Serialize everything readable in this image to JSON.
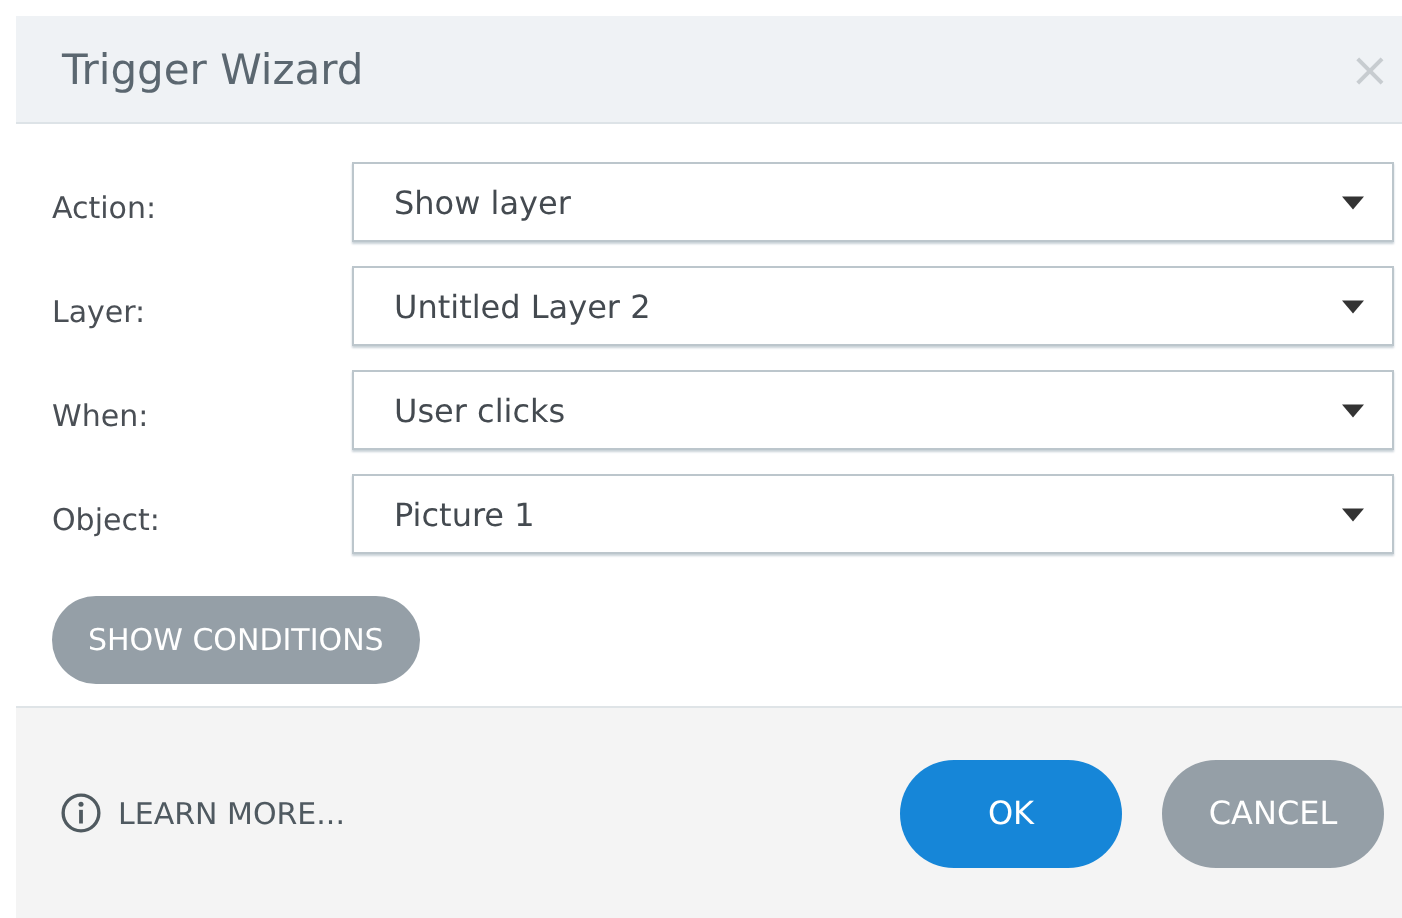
{
  "window": {
    "title": "Trigger Wizard",
    "close": "×"
  },
  "fields": [
    {
      "label": "Action:",
      "value": "Show layer"
    },
    {
      "label": "Layer:",
      "value": "Untitled Layer 2"
    },
    {
      "label": "When:",
      "value": "User clicks"
    },
    {
      "label": "Object:",
      "value": "Picture 1"
    }
  ],
  "conditions_button": "SHOW CONDITIONS",
  "footer": {
    "link": "LEARN MORE...",
    "buttons": [
      {
        "label": "OK",
        "kind": "primary"
      },
      {
        "label": "CANCEL",
        "kind": "secondary"
      }
    ]
  }
}
